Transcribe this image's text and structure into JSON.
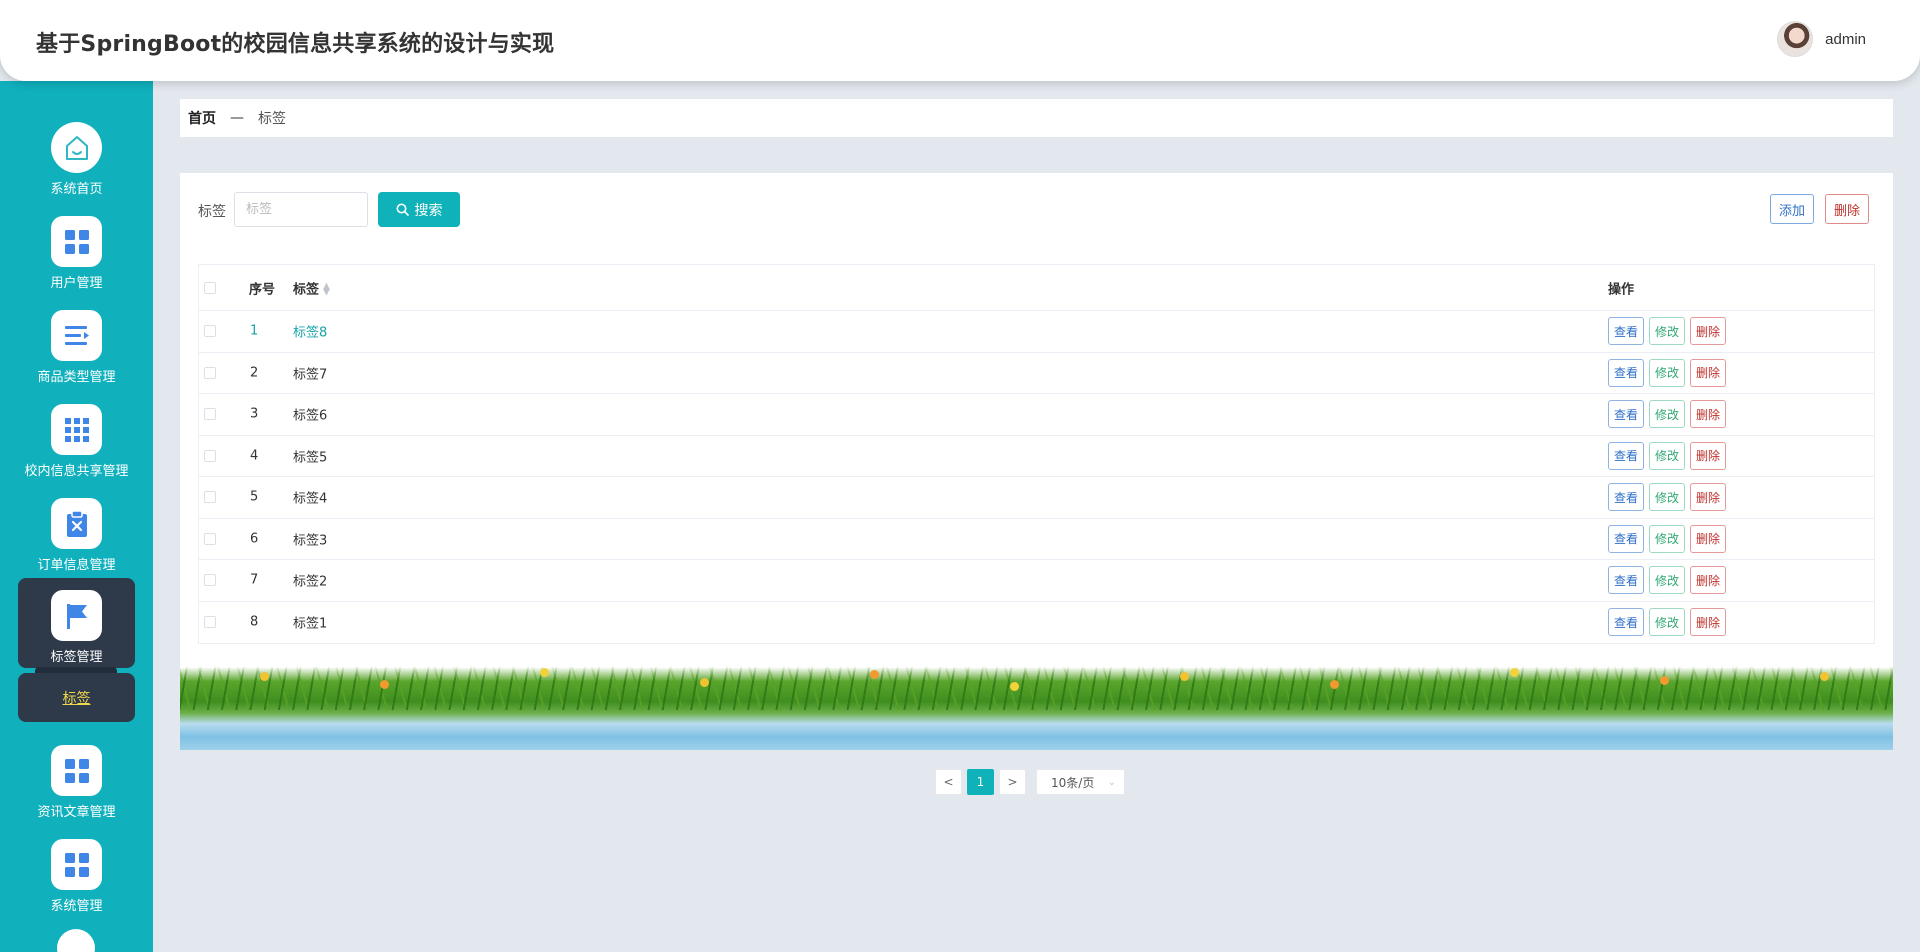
{
  "header": {
    "title": "基于SpringBoot的校园信息共享系统的设计与实现",
    "user_name": "admin"
  },
  "sidebar": {
    "items": [
      {
        "label": "系统首页",
        "icon": "home-icon"
      },
      {
        "label": "用户管理",
        "icon": "grid-icon"
      },
      {
        "label": "商品类型管理",
        "icon": "list-icon"
      },
      {
        "label": "校内信息共享管理",
        "icon": "apps-icon"
      },
      {
        "label": "订单信息管理",
        "icon": "clipboard-icon"
      },
      {
        "label": "标签管理",
        "icon": "flag-icon"
      },
      {
        "label": "资讯文章管理",
        "icon": "grid-icon"
      },
      {
        "label": "系统管理",
        "icon": "grid-icon"
      }
    ],
    "active_item": "标签管理",
    "sub_item": "标签"
  },
  "breadcrumb": {
    "home": "首页",
    "separator": "—",
    "current": "标签"
  },
  "search": {
    "label": "标签",
    "placeholder": "标签",
    "value": "",
    "button_label": "搜索"
  },
  "toolbar": {
    "add_label": "添加",
    "delete_label": "删除"
  },
  "table": {
    "columns": [
      "序号",
      "标签",
      "操作"
    ],
    "rows": [
      {
        "index": "1",
        "tag": "标签8"
      },
      {
        "index": "2",
        "tag": "标签7"
      },
      {
        "index": "3",
        "tag": "标签6"
      },
      {
        "index": "4",
        "tag": "标签5"
      },
      {
        "index": "5",
        "tag": "标签4"
      },
      {
        "index": "6",
        "tag": "标签3"
      },
      {
        "index": "7",
        "tag": "标签2"
      },
      {
        "index": "8",
        "tag": "标签1"
      }
    ],
    "actions": {
      "view": "查看",
      "edit": "修改",
      "delete": "删除"
    }
  },
  "pagination": {
    "prev": "<",
    "current_page": "1",
    "next": ">",
    "page_size": "10条/页"
  },
  "colors": {
    "sidebar_bg": "#10b0bd",
    "accent": "#0fb2b8",
    "active_menu_bg": "#2e3a4a",
    "sub_item_text": "#f2d64b"
  }
}
